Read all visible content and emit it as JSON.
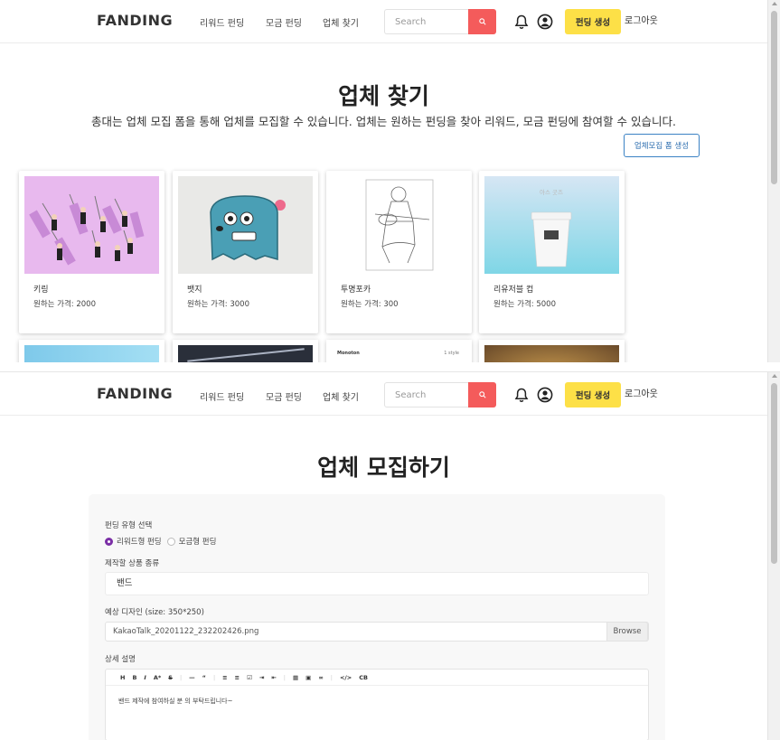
{
  "navbar": {
    "brand": "FANDING",
    "links": [
      "리워드 펀딩",
      "모금 펀딩",
      "업체 찾기"
    ],
    "search_placeholder": "Search",
    "create_label": "펀딩 생성",
    "logout_label": "로그아웃",
    "icons": [
      "search-icon",
      "bell-icon",
      "user-icon"
    ]
  },
  "finder": {
    "title": "업체 찾기",
    "description": "총대는 업체 모집 폼을 통해 업체를 모집할 수 있습니다. 업체는 원하는 펀딩을 찾아 리워드, 모금 펀딩에 참여할 수 있습니다.",
    "recruit_button": "업체모집 폼 생성",
    "cards": [
      {
        "name": "키링",
        "price": "원하는 가격: 2000"
      },
      {
        "name": "뱃지",
        "price": "원하는 가격: 3000"
      },
      {
        "name": "투명포카",
        "price": "원하는 가격: 300"
      },
      {
        "name": "리유저블 컵",
        "price": "원하는 가격: 5000"
      }
    ],
    "cup_text": "아스 굿즈",
    "row2_labels": [
      "Monoton",
      "1 style"
    ]
  },
  "recruit": {
    "title": "업체 모집하기",
    "funding_type_label": "펀딩 유형 선택",
    "option_reward": "리워드형 펀딩",
    "option_donation": "모금형 펀딩",
    "product_label": "제작할 상품 종류",
    "product_value": "밴드",
    "design_label": "예상 디자인 (size: 350*250)",
    "file_name": "KakaoTalk_20201122_232202426.png",
    "browse_label": "Browse",
    "detail_label": "상세 설명",
    "toolbar": [
      "H",
      "B",
      "I",
      "A*",
      "S",
      "—",
      "“",
      "≡",
      "≡",
      "☑",
      "⇥",
      "⇤",
      "▦",
      "▣",
      "∞",
      "</>",
      "CB"
    ],
    "editor_text": "밴드 제작에 참여하실 분 의 부탁드립니다~"
  },
  "colors": {
    "search_button": "#f45b5b",
    "create_button": "#fde047",
    "recruit_border": "#3b82c4",
    "radio_selected": "#7b2fa6"
  }
}
